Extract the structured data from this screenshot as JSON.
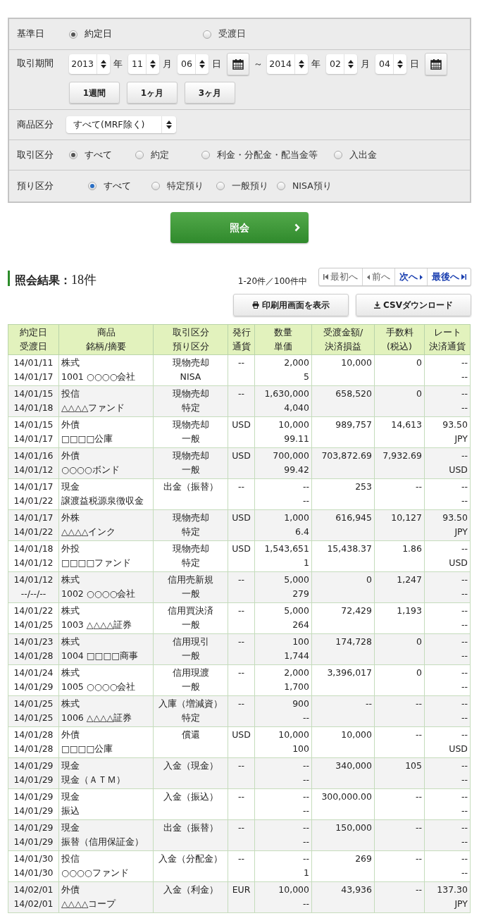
{
  "form": {
    "base_date": {
      "label": "基準日",
      "options": [
        {
          "label": "約定日",
          "selected": true
        },
        {
          "label": "受渡日",
          "selected": false
        }
      ]
    },
    "period": {
      "label": "取引期間",
      "from": [
        {
          "value": "2013",
          "unit": "年"
        },
        {
          "value": "11",
          "unit": "月"
        },
        {
          "value": "06",
          "unit": "日"
        }
      ],
      "separator": "～",
      "to": [
        {
          "value": "2014",
          "unit": "年"
        },
        {
          "value": "02",
          "unit": "月"
        },
        {
          "value": "04",
          "unit": "日"
        }
      ],
      "presets": [
        "1週間",
        "1ヶ月",
        "3ヶ月"
      ]
    },
    "product": {
      "label": "商品区分",
      "value": "すべて(MRF除く)"
    },
    "trade_type": {
      "label": "取引区分",
      "options": [
        {
          "label": "すべて",
          "selected": true
        },
        {
          "label": "約定",
          "selected": false
        },
        {
          "label": "利金・分配金・配当金等",
          "selected": false
        },
        {
          "label": "入出金",
          "selected": false
        }
      ]
    },
    "account_type": {
      "label": "預り区分",
      "options": [
        {
          "label": "すべて",
          "selected": true
        },
        {
          "label": "特定預り",
          "selected": false
        },
        {
          "label": "一般預り",
          "selected": false
        },
        {
          "label": "NISA預り",
          "selected": false
        }
      ]
    },
    "submit": "照会"
  },
  "results": {
    "title": "照会結果：",
    "count": "18件",
    "range": "1-20件／100件中",
    "pager": [
      {
        "label": "最初へ",
        "kind": "first",
        "disabled": true
      },
      {
        "label": "前へ",
        "kind": "prev",
        "disabled": true
      },
      {
        "label": "次へ",
        "kind": "next",
        "disabled": false
      },
      {
        "label": "最後へ",
        "kind": "last",
        "disabled": false
      }
    ],
    "actions": [
      {
        "label": "印刷用画面を表示",
        "kind": "print"
      },
      {
        "label": "CSVダウンロード",
        "kind": "download"
      }
    ]
  },
  "table": {
    "columns": [
      {
        "label": "約定日",
        "sublabel": "受渡日"
      },
      {
        "label": "商品",
        "sublabel": "銘柄/摘要"
      },
      {
        "label": "取引区分",
        "sublabel": "預り区分"
      },
      {
        "label": "発行",
        "sublabel": "通貨"
      },
      {
        "label": "数量",
        "sublabel": "単価"
      },
      {
        "label": "受渡金額/",
        "sublabel": "決済損益"
      },
      {
        "label": "手数料",
        "sublabel": "(税込)"
      },
      {
        "label": "レート",
        "sublabel": "決済通貨"
      }
    ],
    "rows": [
      [
        [
          "14/01/11",
          "14/01/17"
        ],
        [
          "株式",
          "1001 ○○○○会社"
        ],
        [
          "現物売却",
          "NISA"
        ],
        [
          "--"
        ],
        [
          "2,000",
          "5"
        ],
        [
          "10,000"
        ],
        [
          "0"
        ],
        [
          "--",
          "--"
        ]
      ],
      [
        [
          "14/01/15",
          "14/01/18"
        ],
        [
          "投信",
          "△△△△ファンド"
        ],
        [
          "現物売却",
          "特定"
        ],
        [
          "--"
        ],
        [
          "1,630,000",
          "4,040"
        ],
        [
          "658,520"
        ],
        [
          "0"
        ],
        [
          "--",
          "--"
        ]
      ],
      [
        [
          "14/01/15",
          "14/01/17"
        ],
        [
          "外債",
          "□□□□公庫"
        ],
        [
          "現物売却",
          "一般"
        ],
        [
          "USD"
        ],
        [
          "10,000",
          "99.11"
        ],
        [
          "989,757"
        ],
        [
          "14,613"
        ],
        [
          "93.50",
          "JPY"
        ]
      ],
      [
        [
          "14/01/16",
          "14/01/12"
        ],
        [
          "外債",
          "○○○○ボンド"
        ],
        [
          "現物売却",
          "一般"
        ],
        [
          "USD"
        ],
        [
          "700,000",
          "99.42"
        ],
        [
          "703,872.69"
        ],
        [
          "7,932.69"
        ],
        [
          "--",
          "USD"
        ]
      ],
      [
        [
          "14/01/17",
          "14/01/22"
        ],
        [
          "現金",
          "譲渡益税源泉徴収金"
        ],
        [
          "出金（振替）"
        ],
        [
          "--"
        ],
        [
          "--",
          "--"
        ],
        [
          "253"
        ],
        [
          "--"
        ],
        [
          "--",
          "--"
        ]
      ],
      [
        [
          "14/01/17",
          "14/01/22"
        ],
        [
          "外株",
          "△△△△インク"
        ],
        [
          "現物売却",
          "特定"
        ],
        [
          "USD"
        ],
        [
          "1,000",
          "6.4"
        ],
        [
          "616,945"
        ],
        [
          "10,127"
        ],
        [
          "93.50",
          "JPY"
        ]
      ],
      [
        [
          "14/01/18",
          "14/01/12"
        ],
        [
          "外投",
          "□□□□ファンド"
        ],
        [
          "現物売却",
          "特定"
        ],
        [
          "USD"
        ],
        [
          "1,543,651",
          "1"
        ],
        [
          "15,438.37"
        ],
        [
          "1.86"
        ],
        [
          "--",
          "USD"
        ]
      ],
      [
        [
          "14/01/12",
          "--/--/--"
        ],
        [
          "株式",
          "1002 ○○○○会社"
        ],
        [
          "信用売新規",
          "一般"
        ],
        [
          "--"
        ],
        [
          "5,000",
          "279"
        ],
        [
          "0"
        ],
        [
          "1,247"
        ],
        [
          "--",
          "--"
        ]
      ],
      [
        [
          "14/01/22",
          "14/01/25"
        ],
        [
          "株式",
          "1003 △△△△証券"
        ],
        [
          "信用買決済",
          "一般"
        ],
        [
          "--"
        ],
        [
          "5,000",
          "264"
        ],
        [
          "72,429"
        ],
        [
          "1,193"
        ],
        [
          "--",
          "--"
        ]
      ],
      [
        [
          "14/01/23",
          "14/01/28"
        ],
        [
          "株式",
          "1004 □□□□商事"
        ],
        [
          "信用現引",
          "一般"
        ],
        [
          "--"
        ],
        [
          "100",
          "1,744"
        ],
        [
          "174,728"
        ],
        [
          "0"
        ],
        [
          "--",
          "--"
        ]
      ],
      [
        [
          "14/01/24",
          "14/01/29"
        ],
        [
          "株式",
          "1005 ○○○○会社"
        ],
        [
          "信用現渡",
          "一般"
        ],
        [
          "--"
        ],
        [
          "2,000",
          "1,700"
        ],
        [
          "3,396,017"
        ],
        [
          "0"
        ],
        [
          "--",
          "--"
        ]
      ],
      [
        [
          "14/01/25",
          "14/01/25"
        ],
        [
          "株式",
          "1006 △△△△証券"
        ],
        [
          "入庫（増減資）",
          "特定"
        ],
        [
          "--"
        ],
        [
          "900",
          "--"
        ],
        [
          "--"
        ],
        [
          "--"
        ],
        [
          "--",
          "--"
        ]
      ],
      [
        [
          "14/01/28",
          "14/01/28"
        ],
        [
          "外債",
          "□□□□公庫"
        ],
        [
          "償還"
        ],
        [
          "USD"
        ],
        [
          "10,000",
          "100"
        ],
        [
          "10,000"
        ],
        [
          "--"
        ],
        [
          "--",
          "USD"
        ]
      ],
      [
        [
          "14/01/29",
          "14/01/29"
        ],
        [
          "現金",
          "現金（ＡＴＭ）"
        ],
        [
          "入金（現金）"
        ],
        [
          "--"
        ],
        [
          "--",
          "--"
        ],
        [
          "340,000"
        ],
        [
          "105"
        ],
        [
          "--",
          "--"
        ]
      ],
      [
        [
          "14/01/29",
          "14/01/29"
        ],
        [
          "現金",
          "振込"
        ],
        [
          "入金（振込）"
        ],
        [
          "--"
        ],
        [
          "--",
          "--"
        ],
        [
          "300,000.00"
        ],
        [
          "--"
        ],
        [
          "--",
          "--"
        ]
      ],
      [
        [
          "14/01/29",
          "14/01/29"
        ],
        [
          "現金",
          "振替（信用保証金）"
        ],
        [
          "出金（振替）"
        ],
        [
          "--"
        ],
        [
          "--",
          "--"
        ],
        [
          "150,000"
        ],
        [
          "--"
        ],
        [
          "--",
          "--"
        ]
      ],
      [
        [
          "14/01/30",
          "14/01/30"
        ],
        [
          "投信",
          "○○○○ファンド"
        ],
        [
          "入金（分配金）"
        ],
        [
          "--"
        ],
        [
          "--",
          "1"
        ],
        [
          "269"
        ],
        [
          "--"
        ],
        [
          "--",
          "--"
        ]
      ],
      [
        [
          "14/02/01",
          "14/02/01"
        ],
        [
          "外債",
          "△△△△コープ"
        ],
        [
          "入金（利金）"
        ],
        [
          "EUR"
        ],
        [
          "10,000",
          "--"
        ],
        [
          "43,936"
        ],
        [
          "--"
        ],
        [
          "137.30",
          "JPY"
        ]
      ]
    ]
  }
}
